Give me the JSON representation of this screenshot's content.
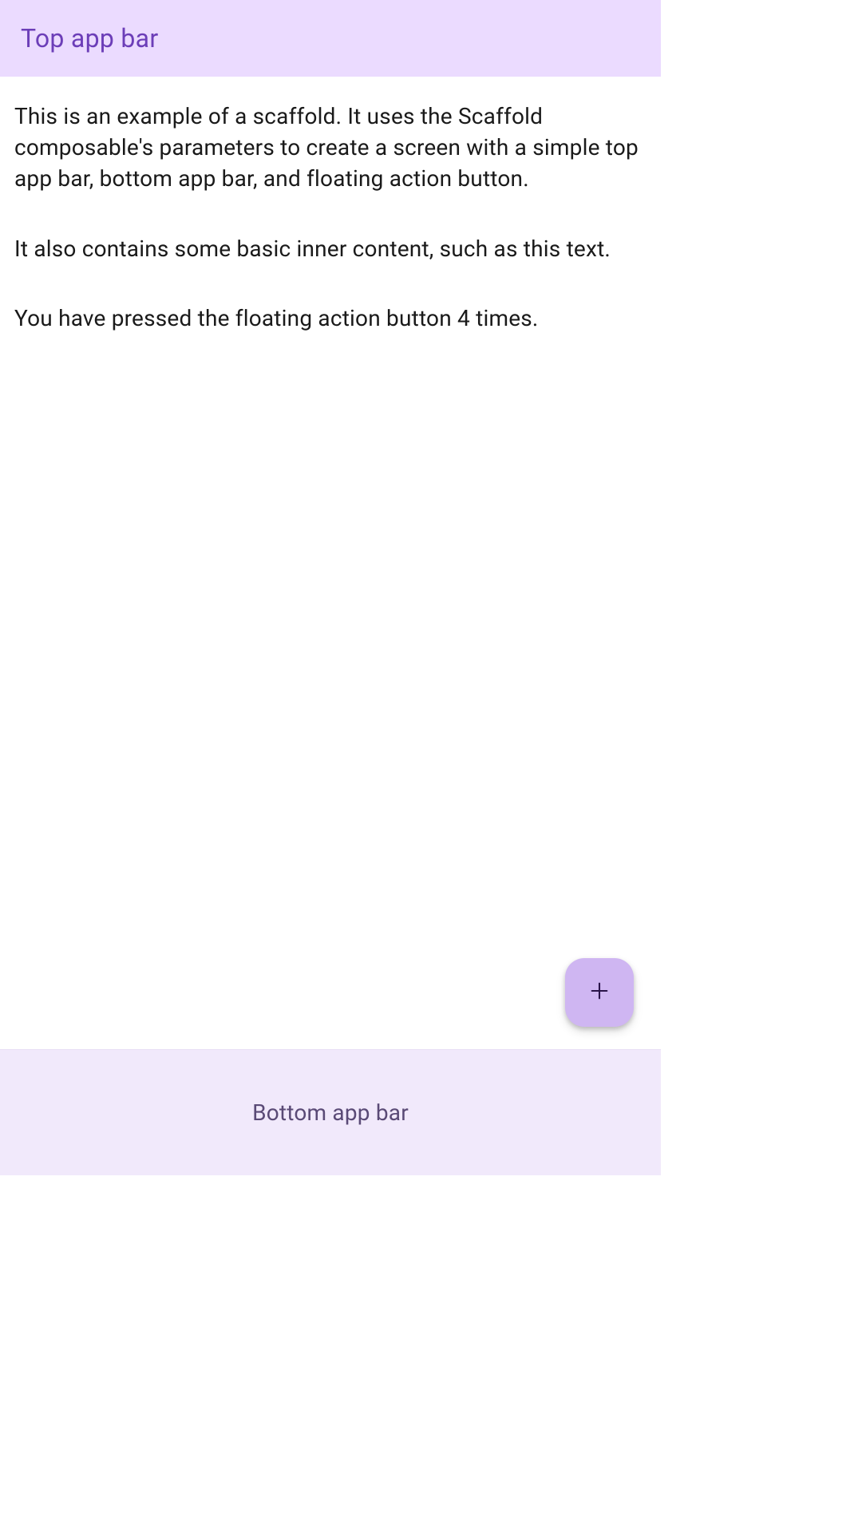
{
  "topAppBar": {
    "title": "Top app bar"
  },
  "content": {
    "paragraph1": "This is an example of a scaffold. It uses the Scaffold composable's parameters to create a screen with a simple top app bar, bottom app bar, and floating action button.",
    "paragraph2": "It also contains some basic inner content, such as this text.",
    "paragraph3": "You have pressed the floating action button 4 times."
  },
  "bottomAppBar": {
    "label": "Bottom app bar"
  },
  "fab": {
    "iconName": "add-icon"
  },
  "colors": {
    "topBarBg": "#ebdbff",
    "topBarText": "#6c3eb8",
    "bottomBarBg": "#f1e9fb",
    "bottomBarText": "#5a4a76",
    "fabBg": "#cfb6f2",
    "fabIcon": "#2a1449",
    "bodyText": "#1a1a1a"
  },
  "pressCount": 4
}
